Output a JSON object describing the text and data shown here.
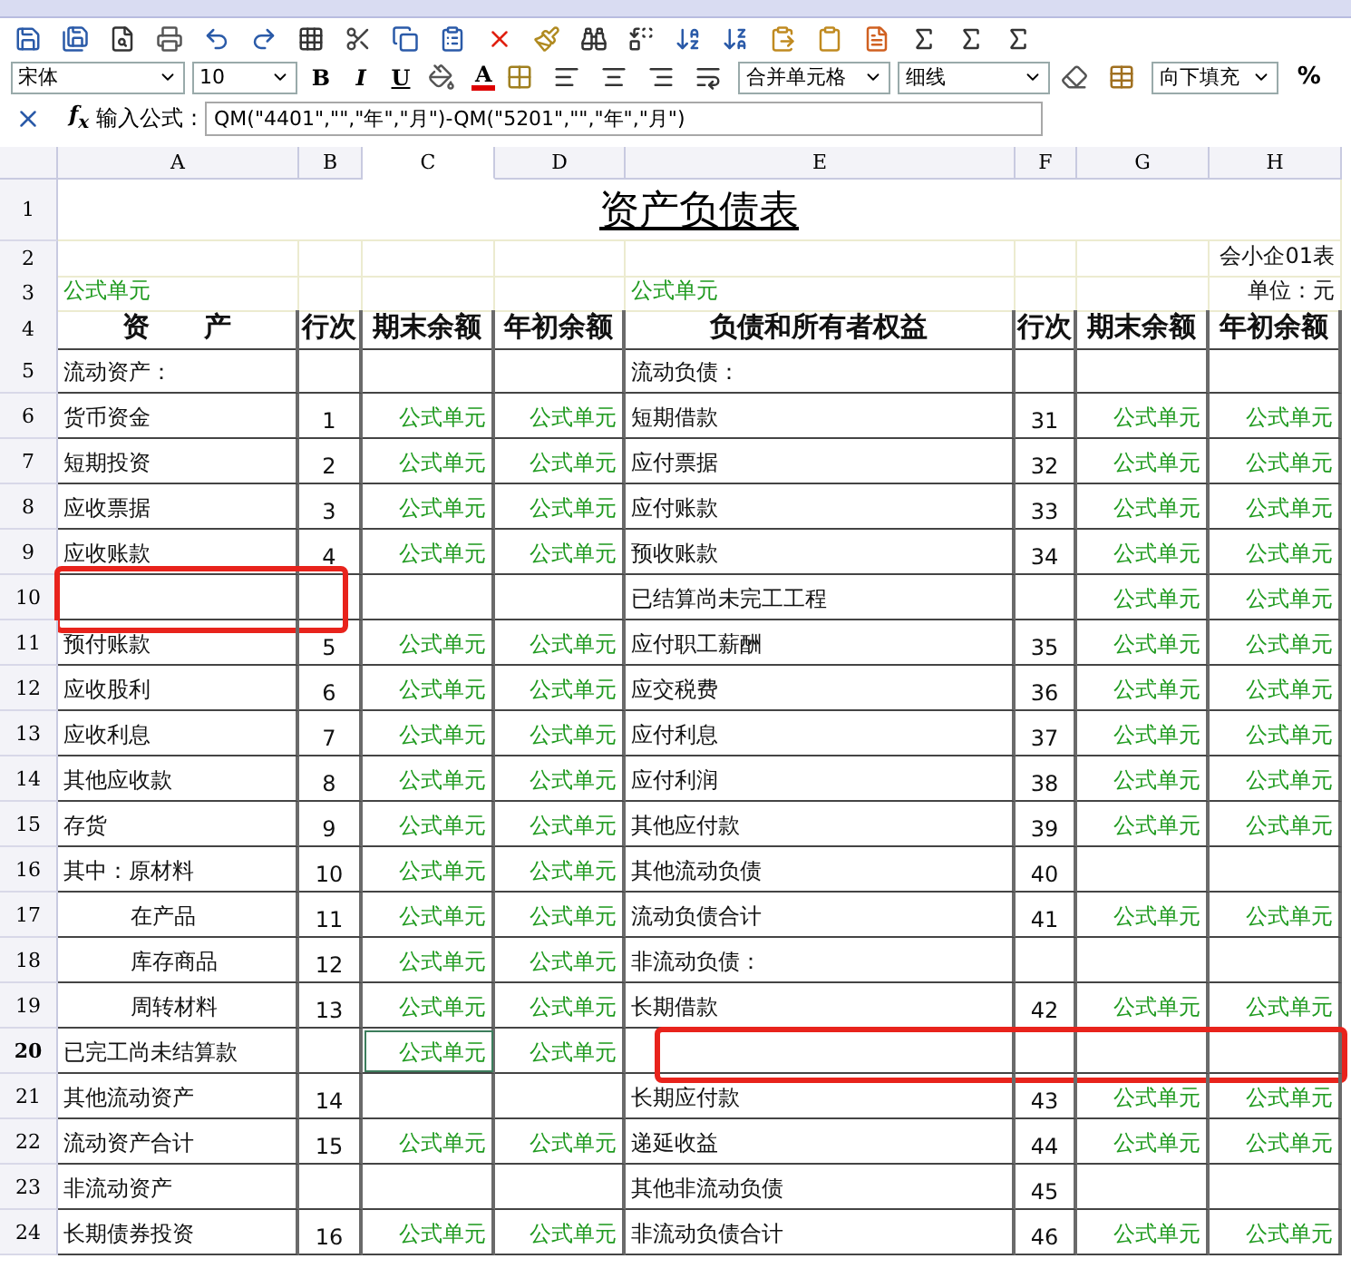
{
  "font_select": {
    "value": "宋体"
  },
  "size_select": {
    "value": "10"
  },
  "format_buttons": [
    "B",
    "I",
    "U"
  ],
  "font_color_label": "A",
  "merge_select": {
    "value": "合并单元格"
  },
  "border_select": {
    "value": "细线"
  },
  "fill_select": {
    "value": "向下填充"
  },
  "percent_button": "%",
  "formula_bar": {
    "fx": "f$_{x}$",
    "label": "输入公式 :",
    "value": "QM(\"4401\",\"\",\"年\",\"月\")-QM(\"5201\",\"\",\"年\",\"月\")"
  },
  "columns": [
    {
      "label": "A",
      "selected": false
    },
    {
      "label": "B",
      "selected": false
    },
    {
      "label": "C",
      "selected": true
    },
    {
      "label": "D",
      "selected": false
    },
    {
      "label": "E",
      "selected": false
    },
    {
      "label": "F",
      "selected": false
    },
    {
      "label": "G",
      "selected": false
    },
    {
      "label": "H",
      "selected": false
    }
  ],
  "rows": [
    {
      "kind": "title",
      "num": "1",
      "selected": false,
      "title": "资产负债表"
    },
    {
      "kind": "note",
      "num": "2",
      "selected": false,
      "h": "会小企01表"
    },
    {
      "kind": "note",
      "num": "3",
      "selected": false,
      "a": "公式单元",
      "e": "公式单元",
      "h": "单位：元"
    },
    {
      "kind": "header",
      "num": "4",
      "selected": false,
      "a": "资　　产",
      "b": "行次",
      "c": "期末余额",
      "d": "年初余额",
      "e": "负债和所有者权益",
      "f": "行次",
      "g": "期末余额",
      "h": "年初余额"
    },
    {
      "kind": "body",
      "num": "5",
      "selected": false,
      "frame_left": false,
      "frame_right": false,
      "indented": false,
      "a": "流动资产：",
      "e": "流动负债："
    },
    {
      "kind": "body",
      "num": "6",
      "selected": false,
      "frame_left": false,
      "frame_right": false,
      "indented": false,
      "a": "货币资金",
      "b": "1",
      "c": "公式单元",
      "d": "公式单元",
      "e": "短期借款",
      "f": "31",
      "g": "公式单元",
      "h": "公式单元"
    },
    {
      "kind": "body",
      "num": "7",
      "selected": false,
      "frame_left": false,
      "frame_right": false,
      "indented": false,
      "a": "短期投资",
      "b": "2",
      "c": "公式单元",
      "d": "公式单元",
      "e": "应付票据",
      "f": "32",
      "g": "公式单元",
      "h": "公式单元"
    },
    {
      "kind": "body",
      "num": "8",
      "selected": false,
      "frame_left": false,
      "frame_right": false,
      "indented": false,
      "a": "应收票据",
      "b": "3",
      "c": "公式单元",
      "d": "公式单元",
      "e": "应付账款",
      "f": "33",
      "g": "公式单元",
      "h": "公式单元"
    },
    {
      "kind": "body",
      "num": "9",
      "selected": false,
      "frame_left": false,
      "frame_right": false,
      "indented": false,
      "a": "应收账款",
      "b": "4",
      "c": "公式单元",
      "d": "公式单元",
      "e": "预收账款",
      "f": "34",
      "g": "公式单元",
      "h": "公式单元"
    },
    {
      "kind": "body",
      "num": "10",
      "selected": false,
      "frame_left": true,
      "frame_right": false,
      "e": "已结算尚未完工工程",
      "g": "公式单元",
      "h": "公式单元"
    },
    {
      "kind": "body",
      "num": "11",
      "selected": false,
      "frame_left": false,
      "frame_right": false,
      "indented": false,
      "a": "预付账款",
      "b": "5",
      "c": "公式单元",
      "d": "公式单元",
      "e": "应付职工薪酬",
      "f": "35",
      "g": "公式单元",
      "h": "公式单元"
    },
    {
      "kind": "body",
      "num": "12",
      "selected": false,
      "frame_left": false,
      "frame_right": false,
      "indented": false,
      "a": "应收股利",
      "b": "6",
      "c": "公式单元",
      "d": "公式单元",
      "e": "应交税费",
      "f": "36",
      "g": "公式单元",
      "h": "公式单元"
    },
    {
      "kind": "body",
      "num": "13",
      "selected": false,
      "frame_left": false,
      "frame_right": false,
      "indented": false,
      "a": "应收利息",
      "b": "7",
      "c": "公式单元",
      "d": "公式单元",
      "e": "应付利息",
      "f": "37",
      "g": "公式单元",
      "h": "公式单元"
    },
    {
      "kind": "body",
      "num": "14",
      "selected": false,
      "frame_left": false,
      "frame_right": false,
      "indented": false,
      "a": "其他应收款",
      "b": "8",
      "c": "公式单元",
      "d": "公式单元",
      "e": "应付利润",
      "f": "38",
      "g": "公式单元",
      "h": "公式单元"
    },
    {
      "kind": "body",
      "num": "15",
      "selected": false,
      "frame_left": false,
      "frame_right": false,
      "indented": false,
      "a": "存货",
      "b": "9",
      "c": "公式单元",
      "d": "公式单元",
      "e": "其他应付款",
      "f": "39",
      "g": "公式单元",
      "h": "公式单元"
    },
    {
      "kind": "body",
      "num": "16",
      "selected": false,
      "frame_left": false,
      "frame_right": false,
      "indented": false,
      "a": "其中：原材料",
      "b": "10",
      "c": "公式单元",
      "d": "公式单元",
      "e": "其他流动负债",
      "f": "40"
    },
    {
      "kind": "body",
      "num": "17",
      "selected": false,
      "frame_left": false,
      "frame_right": false,
      "indented": true,
      "a": "在产品",
      "b": "11",
      "c": "公式单元",
      "d": "公式单元",
      "e": "流动负债合计",
      "f": "41",
      "g": "公式单元",
      "h": "公式单元"
    },
    {
      "kind": "body",
      "num": "18",
      "selected": false,
      "frame_left": false,
      "frame_right": false,
      "indented": true,
      "a": "库存商品",
      "b": "12",
      "c": "公式单元",
      "d": "公式单元",
      "e": "非流动负债："
    },
    {
      "kind": "body",
      "num": "19",
      "selected": false,
      "frame_left": false,
      "frame_right": false,
      "indented": true,
      "a": "周转材料",
      "b": "13",
      "c": "公式单元",
      "d": "公式单元",
      "e": "长期借款",
      "f": "42",
      "g": "公式单元",
      "h": "公式单元"
    },
    {
      "kind": "body",
      "num": "20",
      "selected": true,
      "frame_left": false,
      "frame_right": true,
      "indented": false,
      "a": "已完工尚未结算款",
      "c": "公式单元",
      "d": "公式单元"
    },
    {
      "kind": "body",
      "num": "21",
      "selected": false,
      "frame_left": false,
      "frame_right": false,
      "indented": false,
      "a": "其他流动资产",
      "b": "14",
      "e": "长期应付款",
      "f": "43",
      "g": "公式单元",
      "h": "公式单元"
    },
    {
      "kind": "body",
      "num": "22",
      "selected": false,
      "frame_left": false,
      "frame_right": false,
      "indented": false,
      "a": "流动资产合计",
      "b": "15",
      "c": "公式单元",
      "d": "公式单元",
      "e": "递延收益",
      "f": "44",
      "g": "公式单元",
      "h": "公式单元"
    },
    {
      "kind": "body",
      "num": "23",
      "selected": false,
      "frame_left": false,
      "frame_right": false,
      "indented": false,
      "a": "非流动资产",
      "e": "其他非流动负债",
      "f": "45"
    },
    {
      "kind": "body",
      "num": "24",
      "selected": false,
      "frame_left": false,
      "frame_right": false,
      "indented": false,
      "a": "长期债券投资",
      "b": "16",
      "c": "公式单元",
      "d": "公式单元",
      "e": "非流动负债合计",
      "f": "46",
      "g": "公式单元",
      "h": "公式单元"
    }
  ]
}
